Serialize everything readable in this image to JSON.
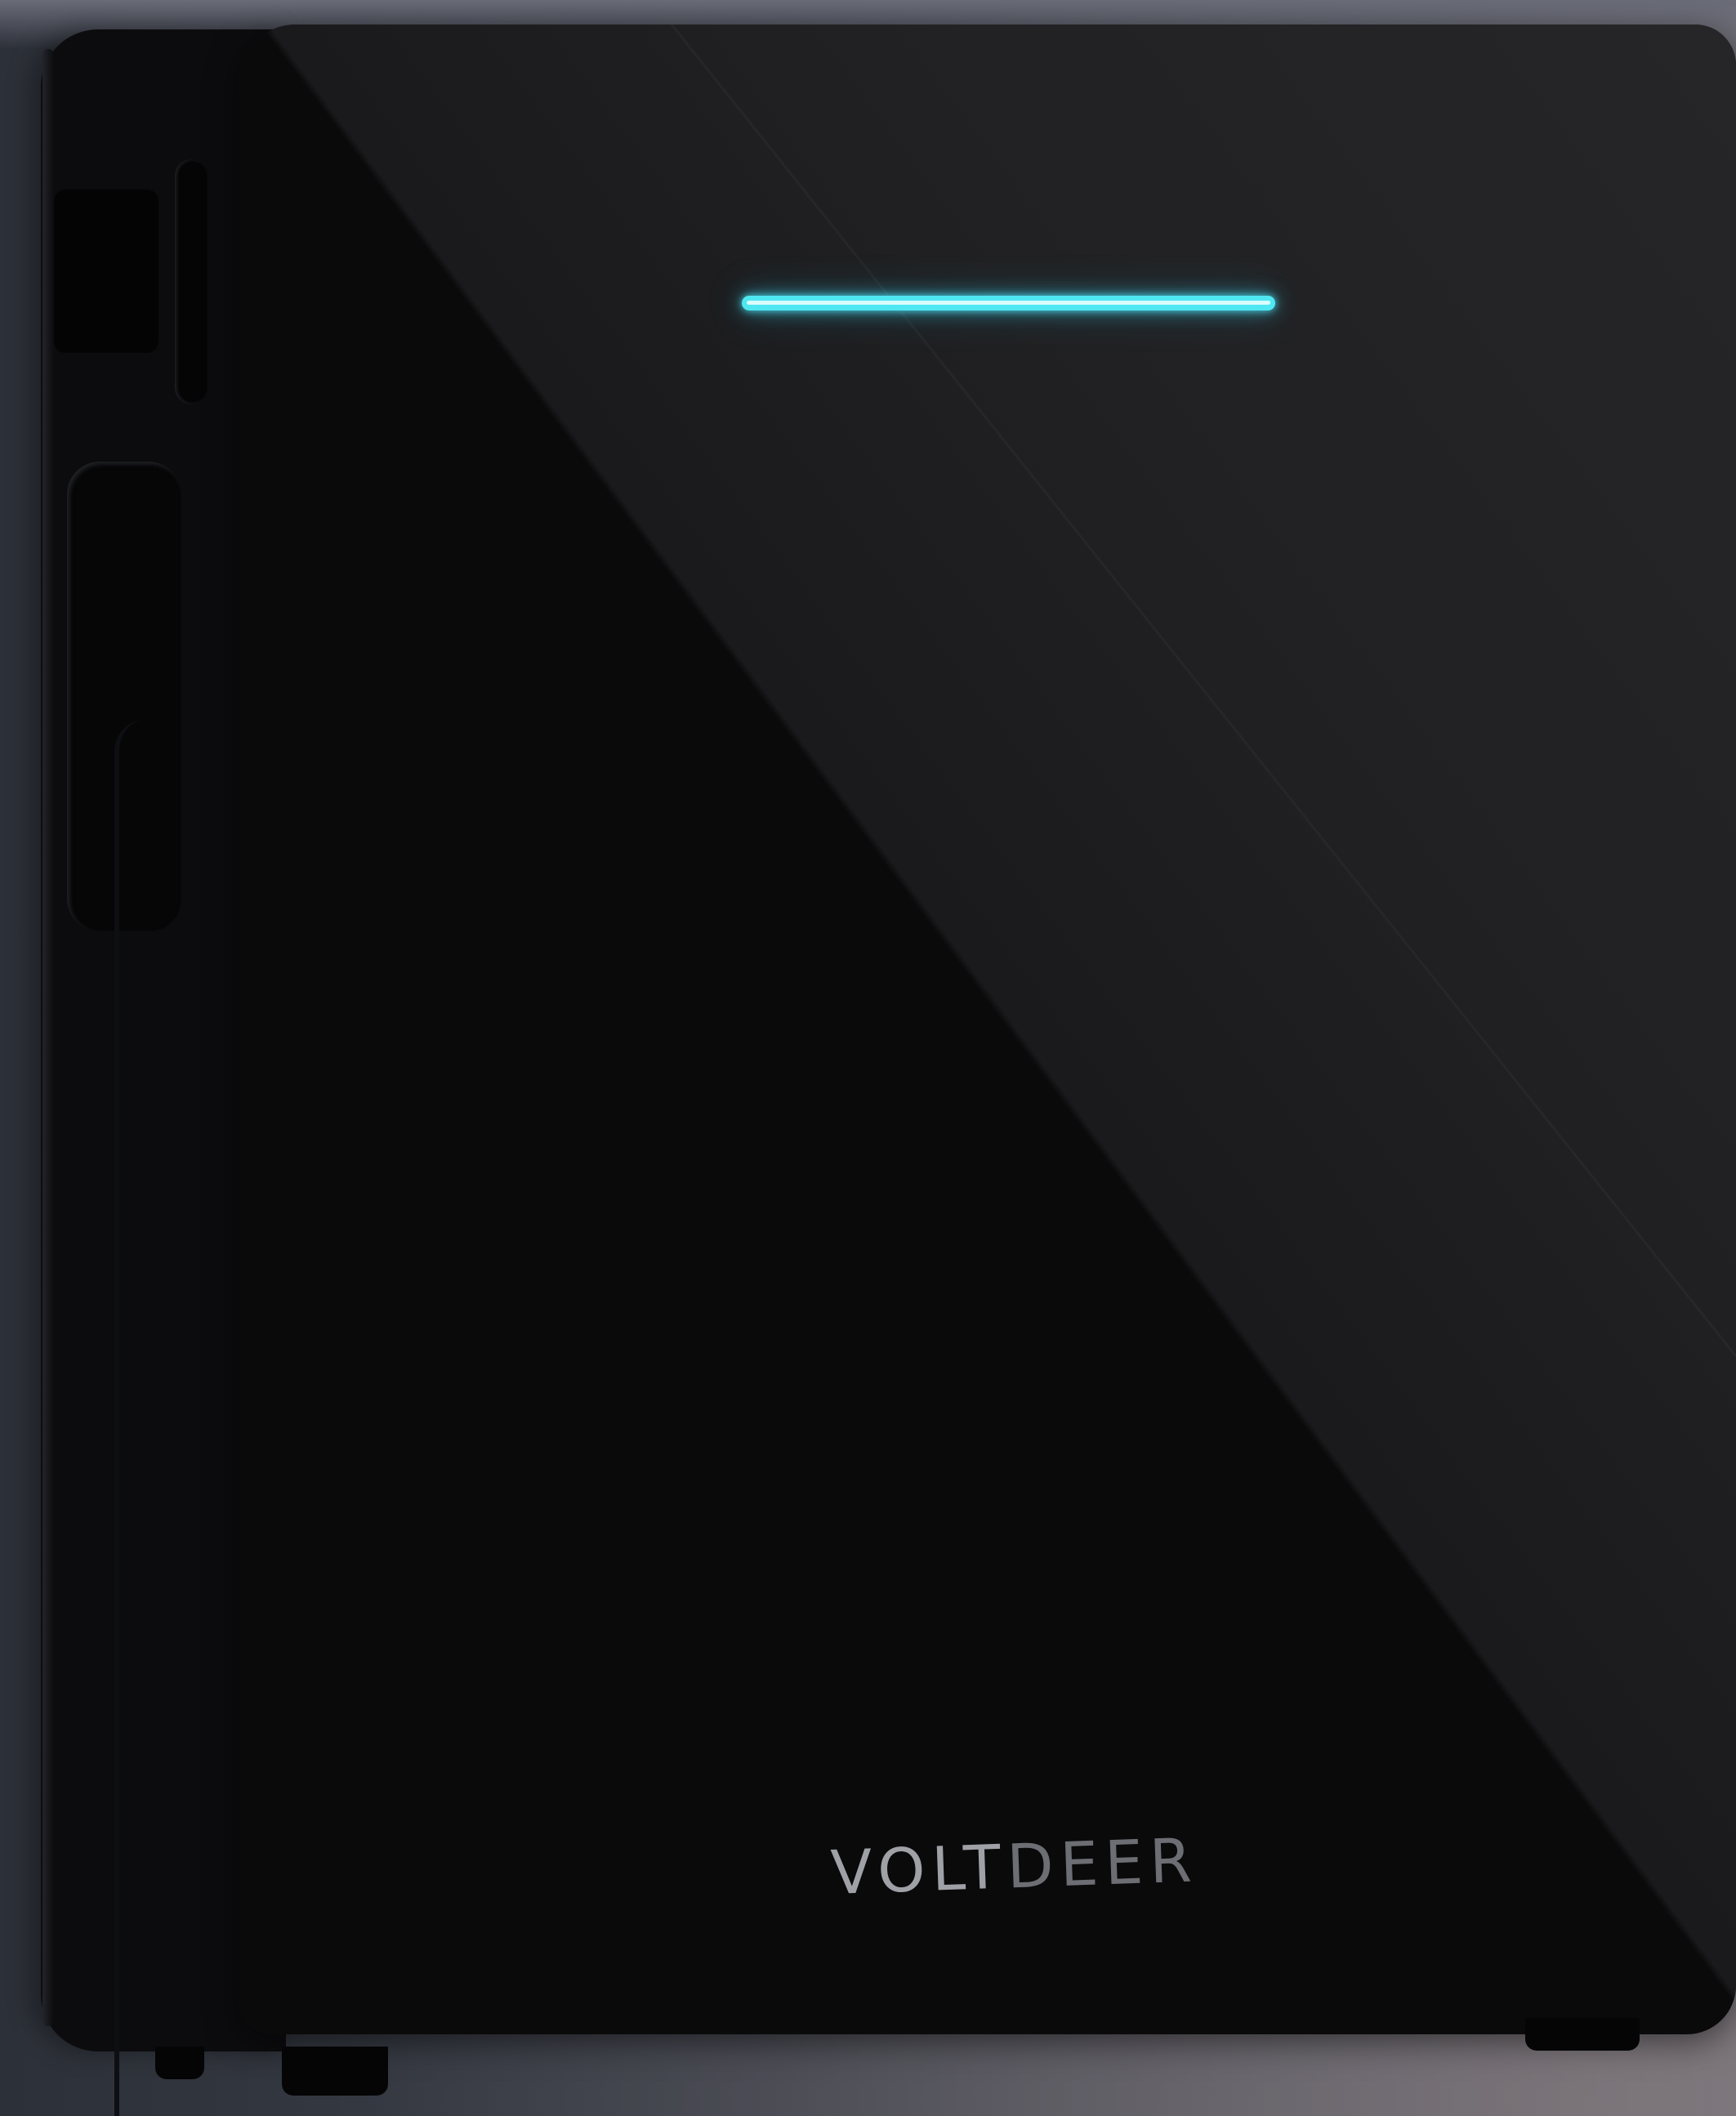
{
  "scene": {
    "subject": "wall-mounted-battery-unit",
    "colors": {
      "panel": "#0a0a0b",
      "led": "#4fe8f2",
      "wall": "#3d414b"
    }
  },
  "brand": {
    "part1": "VOLT",
    "part2": "DEER"
  },
  "status_light": {
    "color": "#4fe8f2",
    "state": "on"
  }
}
